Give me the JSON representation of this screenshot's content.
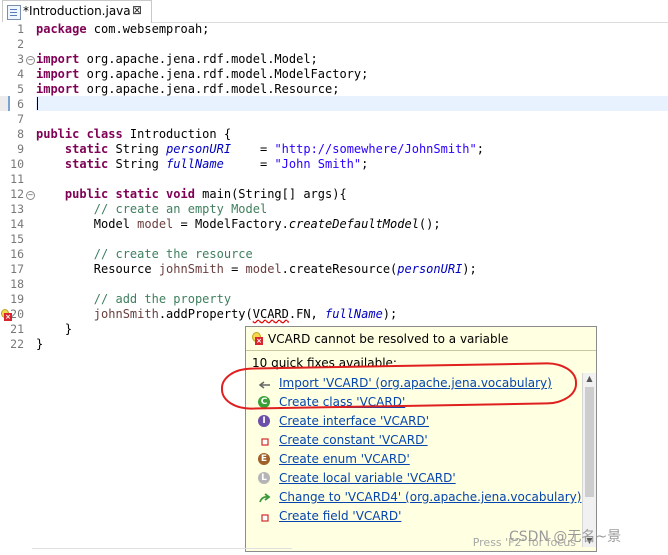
{
  "tab": {
    "title": "*Introduction.java",
    "close_glyph": "⊠"
  },
  "code": {
    "line_numbers": [
      "1",
      "2",
      "3",
      "4",
      "5",
      "6",
      "7",
      "8",
      "9",
      "10",
      "11",
      "12",
      "13",
      "14",
      "15",
      "16",
      "17",
      "18",
      "19",
      "20",
      "21",
      "22"
    ],
    "fold_marks": {
      "line3": "−",
      "line12": "−"
    },
    "l1": {
      "kw": "package",
      "rest": " com.websemproah;"
    },
    "l3": {
      "kw": "import",
      "rest": " org.apache.jena.rdf.model.Model;"
    },
    "l4": {
      "kw": "import",
      "rest": " org.apache.jena.rdf.model.ModelFactory;"
    },
    "l5": {
      "kw": "import",
      "rest": " org.apache.jena.rdf.model.Resource;"
    },
    "l8": {
      "kw": "public class",
      "rest": " Introduction {"
    },
    "l9": {
      "kw": "static",
      "type": " String ",
      "field": "personURI",
      "eq": "    = ",
      "str": "\"http://somewhere/JohnSmith\"",
      "end": ";"
    },
    "l10": {
      "kw": "static",
      "type": " String ",
      "field": "fullName",
      "eq": "     = ",
      "str": "\"John Smith\"",
      "end": ";"
    },
    "l12": {
      "kw": "public static void",
      "rest": " main(String[] args){"
    },
    "l13": {
      "cmt": "// create an empty Model"
    },
    "l14": {
      "pre": "Model ",
      "var": "model",
      "mid": " = ModelFactory.",
      "call": "createDefaultModel",
      "end": "();"
    },
    "l16": {
      "cmt": "// create the resource"
    },
    "l17": {
      "pre": "Resource ",
      "var": "johnSmith",
      "mid": " = ",
      "var2": "model",
      "mid2": ".createResource(",
      "field": "personURI",
      "end": ");"
    },
    "l19": {
      "cmt": "// add the property"
    },
    "l20": {
      "var": "johnSmith",
      "mid": ".addProperty(",
      "err": "VCARD",
      "mid2": ".FN, ",
      "field": "fullName",
      "end": ");"
    },
    "l21": {
      "text": "}"
    },
    "l22": {
      "text": "}"
    }
  },
  "popup": {
    "error_message": "VCARD cannot be resolved to a variable",
    "quick_fix_count": "10 quick fixes available:",
    "fixes": [
      {
        "label": "Import 'VCARD' (org.apache.jena.vocabulary)",
        "icon": "import-arrow-icon"
      },
      {
        "label": "Create class 'VCARD'",
        "icon": "class-c-icon"
      },
      {
        "label": "Create interface 'VCARD'",
        "icon": "interface-i-icon"
      },
      {
        "label": "Create constant 'VCARD'",
        "icon": "constant-square-icon"
      },
      {
        "label": "Create enum 'VCARD'",
        "icon": "enum-e-icon"
      },
      {
        "label": "Create local variable 'VCARD'",
        "icon": "local-variable-icon"
      },
      {
        "label": "Change to 'VCARD4' (org.apache.jena.vocabulary)",
        "icon": "change-arrow-icon"
      },
      {
        "label": "Create field 'VCARD'",
        "icon": "field-square-icon"
      }
    ],
    "footer_hint": "Press 'F2' for focus"
  },
  "watermark": "CSDN @无名~景",
  "colors": {
    "keyword": "#7f0055",
    "string": "#2a00ff",
    "field": "#0000c0",
    "comment": "#3f7f5f",
    "link": "#0645ad",
    "popup_bg": "#ffffe1",
    "annotation": "#e02020"
  }
}
